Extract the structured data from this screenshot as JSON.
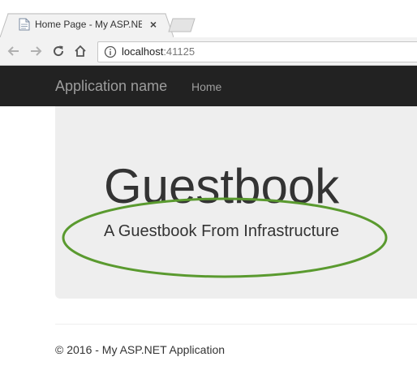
{
  "browser": {
    "tab": {
      "title": "Home Page - My ASP.NE",
      "close_glyph": "×",
      "favicon": "document-icon"
    },
    "address_bar": {
      "host": "localhost",
      "port": ":41125",
      "info_icon": "info-icon"
    },
    "nav_icons": [
      "back-arrow-icon",
      "forward-arrow-icon",
      "reload-icon",
      "home-icon"
    ]
  },
  "navbar": {
    "brand": "Application name",
    "links": [
      {
        "label": "Home"
      }
    ]
  },
  "jumbotron": {
    "title": "Guestbook",
    "lead": "A Guestbook From Infrastructure"
  },
  "footer": {
    "text": "© 2016 - My ASP.NET Application"
  },
  "colors": {
    "navbar_bg": "#222222",
    "jumbotron_bg": "#eeeeee",
    "annotation_ellipse": "#5a9a2f",
    "text": "#333333",
    "navbar_text": "#9d9d9d"
  }
}
